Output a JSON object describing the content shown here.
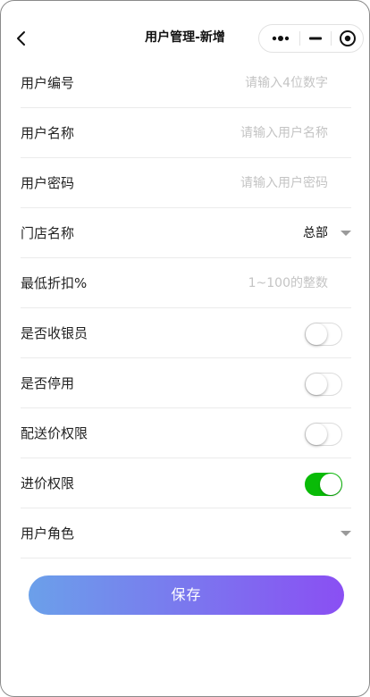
{
  "nav": {
    "title": "用户管理-新增"
  },
  "form": {
    "user_code": {
      "label": "用户编号",
      "value": "",
      "placeholder": "请输入4位数字"
    },
    "user_name": {
      "label": "用户名称",
      "value": "",
      "placeholder": "请输入用户名称"
    },
    "user_password": {
      "label": "用户密码",
      "value": "",
      "placeholder": "请输入用户密码"
    },
    "store_name": {
      "label": "门店名称",
      "selected": "总部"
    },
    "min_discount": {
      "label": "最低折扣%",
      "value": "",
      "placeholder": "1~100的整数"
    },
    "is_cashier": {
      "label": "是否收银员",
      "checked": false
    },
    "is_disabled": {
      "label": "是否停用",
      "checked": false
    },
    "delivery_price_permission": {
      "label": "配送价权限",
      "checked": false
    },
    "purchase_price_permission": {
      "label": "进价权限",
      "checked": true
    },
    "user_role": {
      "label": "用户角色",
      "selected": ""
    }
  },
  "actions": {
    "save_label": "保存"
  },
  "colors": {
    "toggle_on": "#09bb07",
    "button_gradient_start": "#6ba0ea",
    "button_gradient_end": "#8a4ff3",
    "placeholder": "#c4c4c4"
  },
  "icons": {
    "back": "chevron-left-icon",
    "more": "more-dots-icon",
    "minimize": "minimize-icon",
    "close": "target-close-icon",
    "dropdown": "caret-down-icon"
  }
}
